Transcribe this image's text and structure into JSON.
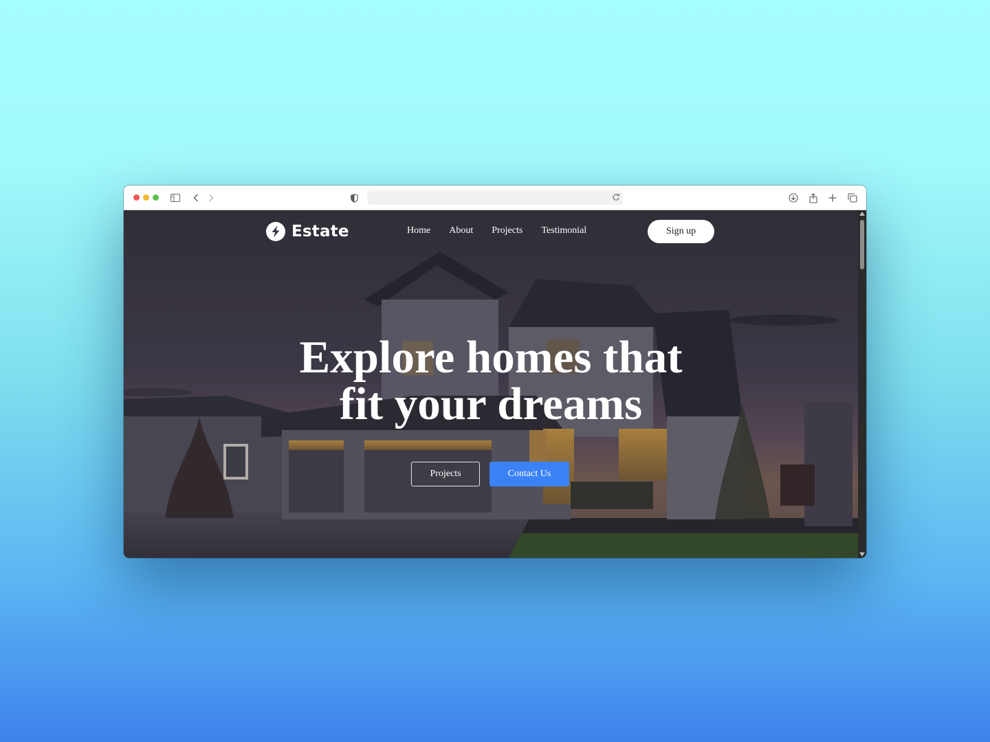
{
  "browser": {
    "icons": [
      "sidebar-icon",
      "back-icon",
      "forward-icon",
      "shield-icon",
      "reload-icon",
      "download-icon",
      "share-icon",
      "new-tab-icon",
      "tabs-icon"
    ],
    "url_text": ""
  },
  "site": {
    "logo_text": "Estate",
    "nav": [
      {
        "label": "Home"
      },
      {
        "label": "About"
      },
      {
        "label": "Projects"
      },
      {
        "label": "Testimonial"
      }
    ],
    "signup_label": "Sign up"
  },
  "hero": {
    "headline_line1": "Explore homes that",
    "headline_line2": "fit your dreams",
    "btn_projects": "Projects",
    "btn_contact": "Contact Us",
    "accent_color": "#3b82f6"
  }
}
